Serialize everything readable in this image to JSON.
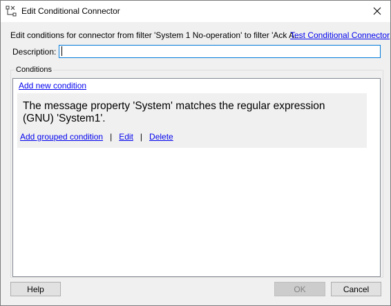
{
  "window": {
    "title": "Edit Conditional Connector",
    "icon": "connector-icon",
    "close_icon": "close-icon"
  },
  "intro": {
    "text": "Edit conditions for connector from filter 'System 1 No-operation' to filter 'Ack A...",
    "test_link": "Test Conditional Connector"
  },
  "description": {
    "label": "Description:",
    "value": ""
  },
  "conditions": {
    "group_label": "Conditions",
    "add_new_link": "Add new condition",
    "items": [
      {
        "text": "The message property 'System' matches the regular expression (GNU) 'System1'.",
        "actions": {
          "add_grouped": "Add grouped condition",
          "separator": "|",
          "edit": "Edit",
          "delete": "Delete"
        }
      }
    ]
  },
  "buttons": {
    "help": "Help",
    "ok": "OK",
    "cancel": "Cancel"
  },
  "colors": {
    "link": "#0000ee",
    "input_border_focus": "#0078d7",
    "card_background": "#f0f0f0"
  }
}
